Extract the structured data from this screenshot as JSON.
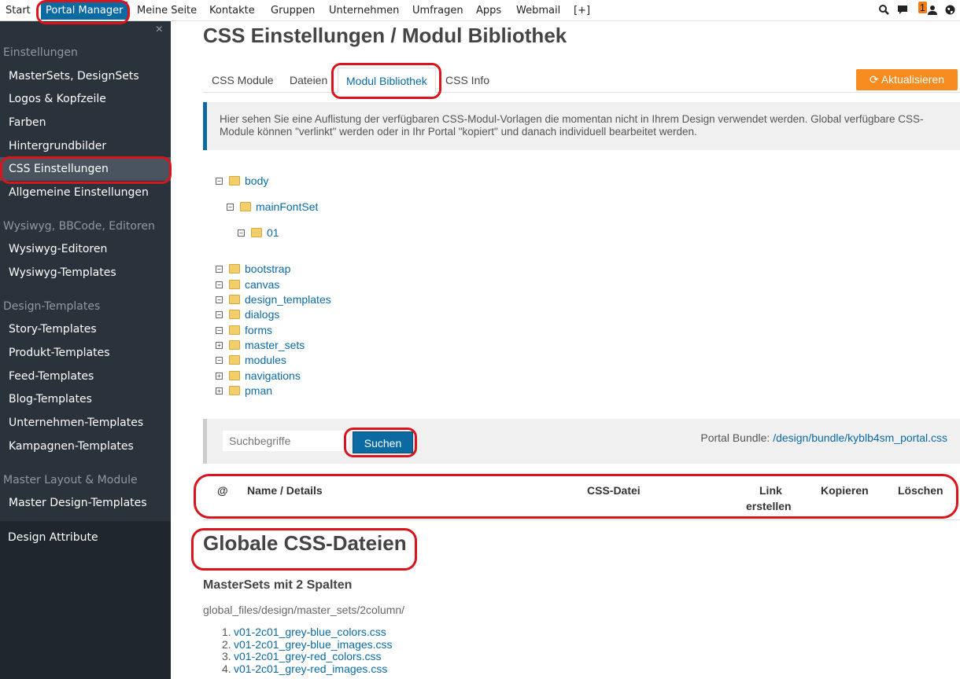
{
  "topnav": {
    "items": [
      "Start",
      "Portal Manager",
      "Meine Seite",
      "Kontakte",
      "Gruppen",
      "Unternehmen",
      "Umfragen",
      "Apps",
      "Webmail",
      "[+]"
    ],
    "notification_count": "1",
    "icons": [
      "zoom-icon",
      "chat-icon",
      "user-icon",
      "globe-icon"
    ]
  },
  "sidebar": {
    "close": "×",
    "sections": {
      "einstellungen": "Einstellungen",
      "editoren": "Wysiwyg, BBCode, Editoren",
      "design_templates": "Design-Templates",
      "master_layout": "Master Layout & Module"
    },
    "links": {
      "mastersets": "MasterSets, DesignSets",
      "logos": "Logos & Kopfzeile",
      "farben": "Farben",
      "hintergrund": "Hintergrundbilder",
      "css": "CSS Einstellungen",
      "allgemein": "Allgemeine Einstellungen",
      "wysiwyg_editoren": "Wysiwyg-Editoren",
      "wysiwyg_templates": "Wysiwyg-Templates",
      "story": "Story-Templates",
      "produkt": "Produkt-Templates",
      "feed": "Feed-Templates",
      "blog": "Blog-Templates",
      "unternehmen": "Unternehmen-Templates",
      "kampagnen": "Kampagnen-Templates",
      "master_design": "Master Design-Templates",
      "design_attribute": "Design Attribute"
    }
  },
  "main": {
    "title": "CSS Einstellungen / Modul Bibliothek",
    "tabs": [
      "CSS Module",
      "Dateien",
      "Modul Bibliothek",
      "CSS Info"
    ],
    "update_button": "⟳ Aktualisieren",
    "info_text": "Hier sehen Sie eine Auflistung der verfügbaren CSS-Modul-Vorlagen die momentan nicht in Ihrem Design verwendet werden. Global verfügbare CSS-Module können \"verlinkt\" werden oder in Ihr Portal \"kopiert\" und danach individuell bearbeitet werden.",
    "tree": {
      "body": "body",
      "mainFontSet": "mainFontSet",
      "n01": "01",
      "bootstrap": "bootstrap",
      "canvas": "canvas",
      "design_templates": "design_templates",
      "dialogs": "dialogs",
      "forms": "forms",
      "master_sets": "master_sets",
      "modules": "modules",
      "navigations": "navigations",
      "pman": "pman"
    },
    "search": {
      "placeholder": "Suchbegriffe",
      "button": "Suchen",
      "bundle_label": "Portal Bundle:",
      "bundle_link": "/design/bundle/kyblb4sm_portal.css"
    },
    "table_headers": {
      "at": "@",
      "name": "Name / Details",
      "css_file": "CSS-Datei",
      "link_1": "Link",
      "link_2": "erstellen",
      "copy": "Kopieren",
      "delete": "Löschen"
    },
    "global_heading": "Globale CSS-Dateien",
    "subheading": "MasterSets mit 2 Spalten",
    "path": "global_files/design/master_sets/2column/",
    "files": [
      "v01-2c01_grey-blue_colors.css",
      "v01-2c01_grey-blue_images.css",
      "v01-2c01_grey-red_colors.css",
      "v01-2c01_grey-red_images.css"
    ]
  }
}
